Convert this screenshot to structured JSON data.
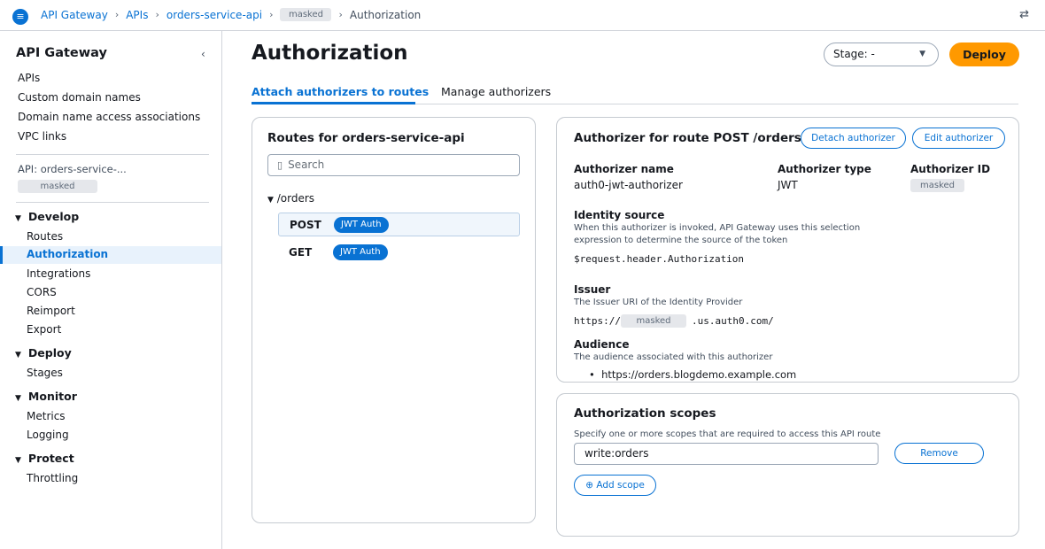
{
  "topbar": {
    "breadcrumbs": [
      "API Gateway",
      "APIs",
      "orders-service-api"
    ],
    "masked": "masked",
    "current": "Authorization",
    "separator": "›"
  },
  "sidebar": {
    "title": "API Gateway",
    "links": [
      "APIs",
      "Custom domain names",
      "Domain name access associations",
      "VPC links"
    ],
    "api_label": "API: orders-service-...",
    "api_masked": "masked",
    "groups": {
      "develop": {
        "label": "Develop",
        "items": [
          "Routes",
          "Authorization",
          "Integrations",
          "CORS",
          "Reimport",
          "Export"
        ]
      },
      "deploy": {
        "label": "Deploy",
        "items": [
          "Stages"
        ]
      },
      "monitor": {
        "label": "Monitor",
        "items": [
          "Metrics",
          "Logging"
        ]
      },
      "protect": {
        "label": "Protect",
        "items": [
          "Throttling"
        ]
      }
    },
    "active_item": "Authorization"
  },
  "header": {
    "title": "Authorization",
    "stage_select": "Stage: -",
    "deploy_label": "Deploy"
  },
  "tabs": [
    "Attach authorizers to routes",
    "Manage authorizers"
  ],
  "routes": {
    "title": "Routes for orders-service-api",
    "search_placeholder": "Search",
    "path": "/orders",
    "items": [
      {
        "method": "POST",
        "badge": "JWT Auth",
        "selected": true
      },
      {
        "method": "GET",
        "badge": "JWT Auth",
        "selected": false
      }
    ]
  },
  "authorizer": {
    "title": "Authorizer for route POST /orders",
    "detach_label": "Detach authorizer",
    "edit_label": "Edit authorizer",
    "name_label": "Authorizer name",
    "name_value": "auth0-jwt-authorizer",
    "type_label": "Authorizer type",
    "type_value": "JWT",
    "id_label": "Authorizer ID",
    "id_masked": "masked",
    "identity_label": "Identity source",
    "identity_desc_1": "When this authorizer is invoked, API Gateway uses this selection",
    "identity_desc_2": "expression to determine the source of the token",
    "identity_value": "$request.header.Authorization",
    "issuer_label": "Issuer",
    "issuer_desc": "The Issuer URI of the Identity Provider",
    "issuer_prefix": "https://",
    "issuer_masked": "masked",
    "issuer_suffix": ".us.auth0.com/",
    "audience_label": "Audience",
    "audience_desc": "The audience associated with this authorizer",
    "audience_value": "https://orders.blogdemo.example.com"
  },
  "scopes": {
    "title": "Authorization scopes",
    "desc": "Specify one or more scopes that are required to access this API route",
    "value": "write:orders",
    "remove_label": "Remove",
    "add_label": "⊕ Add scope"
  },
  "colors": {
    "accent": "#0972d3",
    "deploy": "#ff9900",
    "active_bg": "#e8f2fc"
  },
  "icons": [
    "menu-icon",
    "swap-icon",
    "collapse-icon",
    "search-icon",
    "caret-down-icon"
  ]
}
